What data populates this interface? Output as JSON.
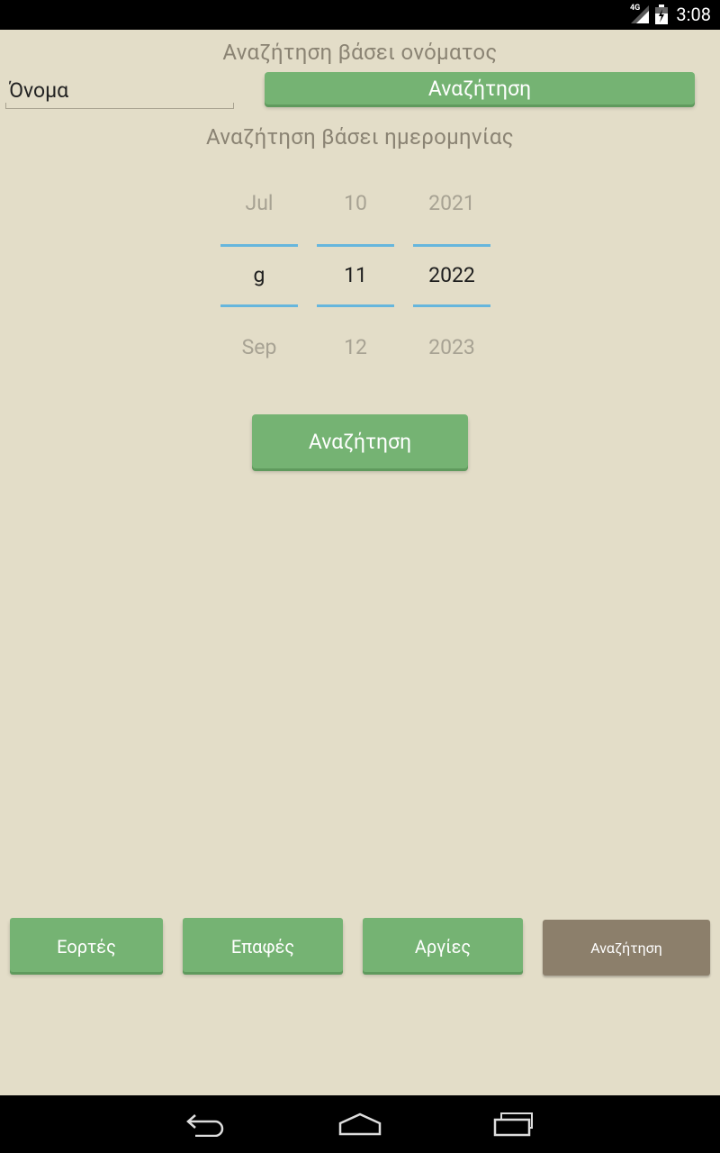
{
  "status_bar": {
    "network_label": "4G",
    "time": "3:08",
    "icons": [
      "signal-icon",
      "battery-icon"
    ]
  },
  "name_search": {
    "title": "Αναζήτηση βάσει ονόματος",
    "input_placeholder": "Όνομα",
    "input_value": "",
    "button_label": "Αναζήτηση"
  },
  "date_search": {
    "title": "Αναζήτηση βάσει ημερομηνίας",
    "month": {
      "prev": "Jul",
      "current": "g",
      "next": "Sep"
    },
    "day": {
      "prev": "10",
      "current": "11",
      "next": "12"
    },
    "year": {
      "prev": "2021",
      "current": "2022",
      "next": "2023"
    },
    "button_label": "Αναζήτηση"
  },
  "tabs": [
    {
      "label": "Εορτές",
      "active": false
    },
    {
      "label": "Επαφές",
      "active": false
    },
    {
      "label": "Αργίες",
      "active": false
    },
    {
      "label": "Αναζήτηση",
      "active": true
    }
  ],
  "nav_bar": {
    "icons": [
      "back-icon",
      "home-icon",
      "recent-apps-icon"
    ]
  },
  "colors": {
    "background": "#e3ddc8",
    "button_green": "#75b373",
    "active_tab": "#8c7f6b",
    "picker_line": "#66b6dd"
  }
}
